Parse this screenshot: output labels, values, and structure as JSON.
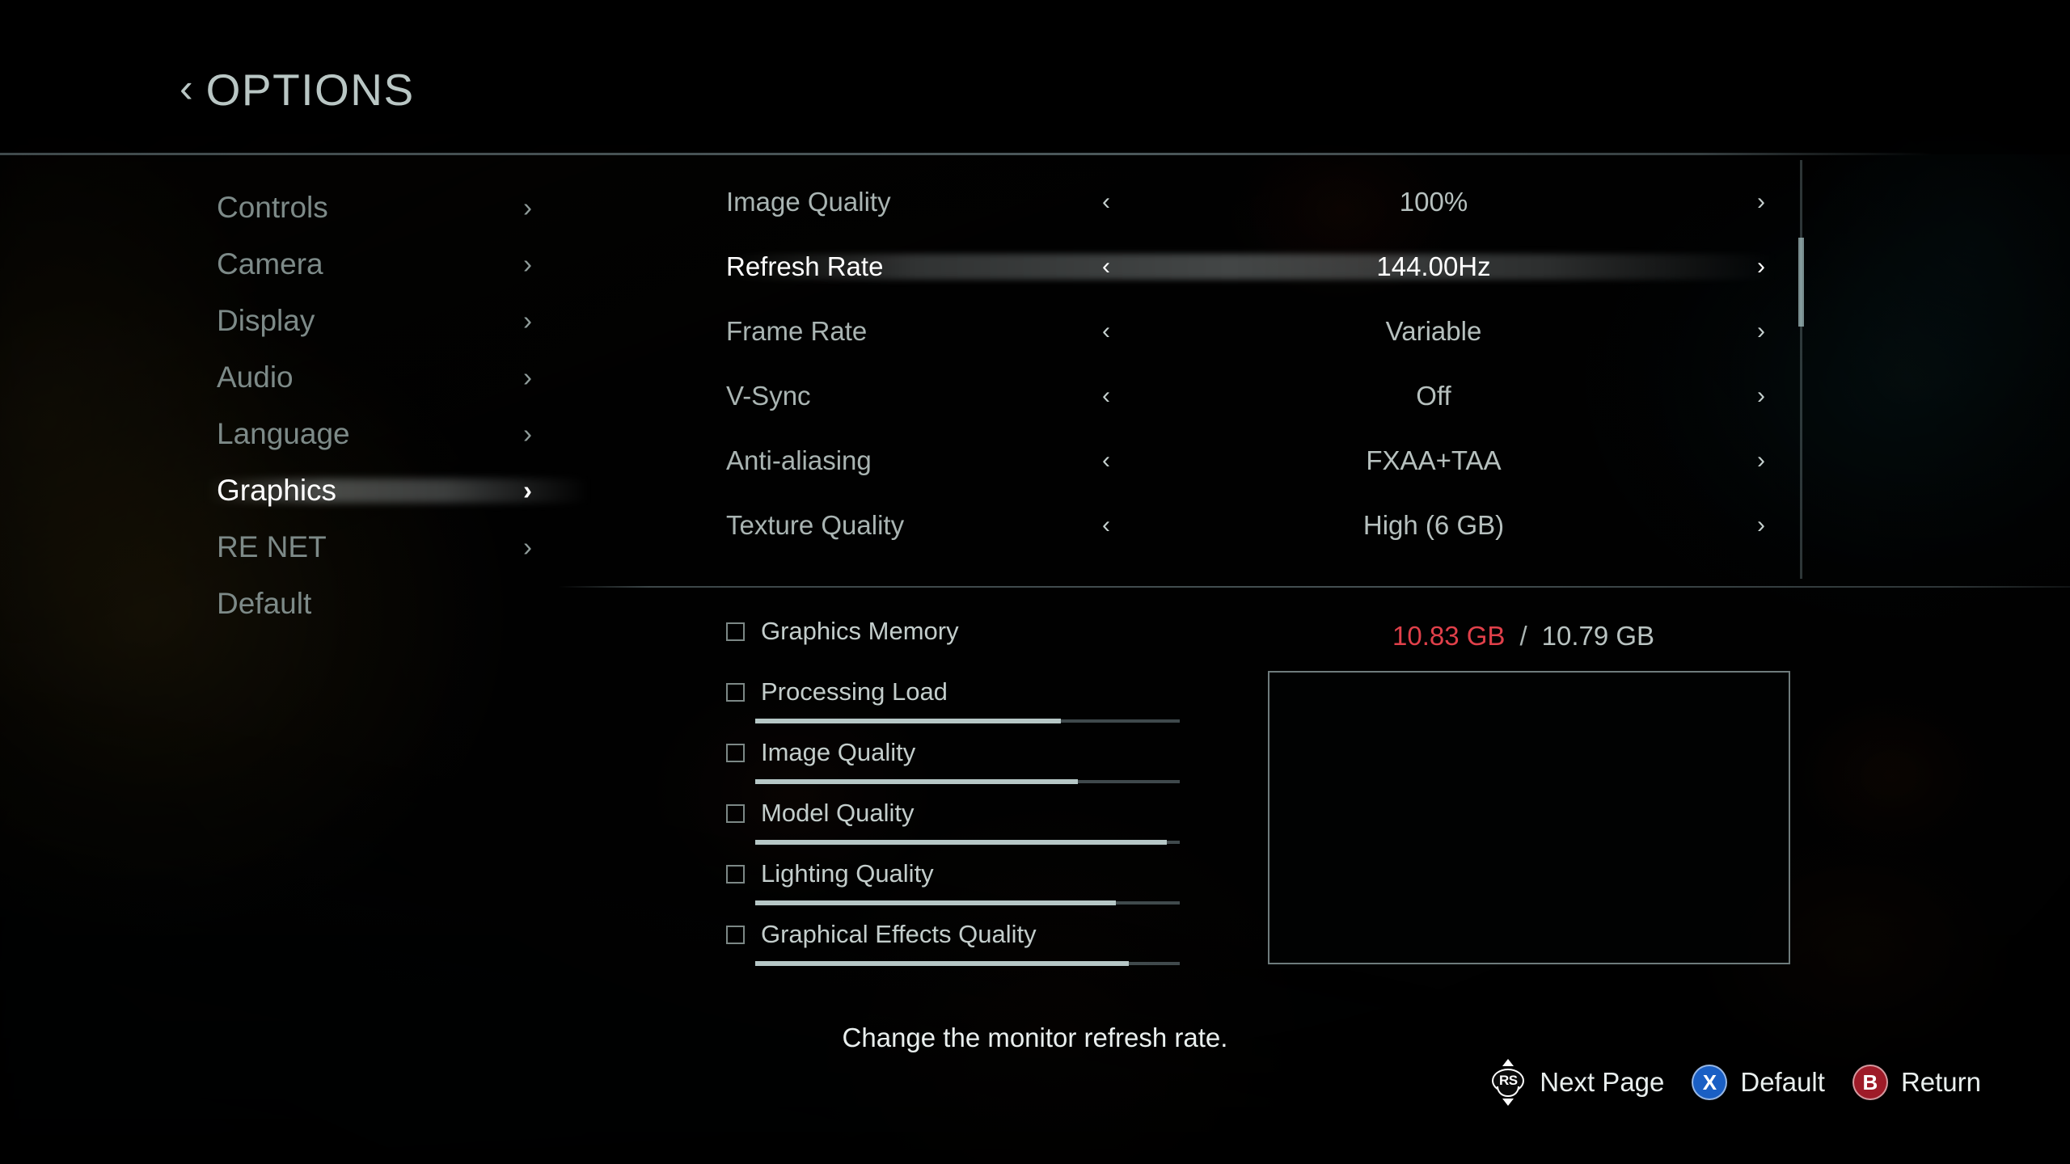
{
  "header": {
    "back_icon": "chevron-left-icon",
    "title": "OPTIONS"
  },
  "sidebar": {
    "items": [
      {
        "label": "Controls",
        "selected": false,
        "chevron": "›"
      },
      {
        "label": "Camera",
        "selected": false,
        "chevron": "›"
      },
      {
        "label": "Display",
        "selected": false,
        "chevron": "›"
      },
      {
        "label": "Audio",
        "selected": false,
        "chevron": "›"
      },
      {
        "label": "Language",
        "selected": false,
        "chevron": "›"
      },
      {
        "label": "Graphics",
        "selected": true,
        "chevron": "›"
      },
      {
        "label": "RE NET",
        "selected": false,
        "chevron": "›"
      },
      {
        "label": "Default",
        "selected": false,
        "chevron": ""
      }
    ]
  },
  "settings": {
    "left_arrow": "‹",
    "right_arrow": "›",
    "rows": [
      {
        "name": "Image Quality",
        "value": "100%",
        "selected": false
      },
      {
        "name": "Refresh Rate",
        "value": "144.00Hz",
        "selected": true
      },
      {
        "name": "Frame Rate",
        "value": "Variable",
        "selected": false
      },
      {
        "name": "V-Sync",
        "value": "Off",
        "selected": false
      },
      {
        "name": "Anti-aliasing",
        "value": "FXAA+TAA",
        "selected": false
      },
      {
        "name": "Texture Quality",
        "value": "High (6 GB)",
        "selected": false
      }
    ],
    "scrollbar": {
      "thumb_top_pct": 18,
      "thumb_height_pct": 21
    }
  },
  "meters": {
    "rows": [
      {
        "label": "Graphics Memory",
        "fill_pct": null
      },
      {
        "label": "Processing Load",
        "fill_pct": 72
      },
      {
        "label": "Image Quality",
        "fill_pct": 76
      },
      {
        "label": "Model Quality",
        "fill_pct": 97
      },
      {
        "label": "Lighting Quality",
        "fill_pct": 85
      },
      {
        "label": "Graphical Effects Quality",
        "fill_pct": 88
      }
    ],
    "memory": {
      "used": "10.83 GB",
      "separator": "/",
      "total": "10.79 GB",
      "used_color": "#e0404a",
      "total_color": "#b9c3c1"
    }
  },
  "preview": {
    "label": "graphics-preview-box"
  },
  "footer": {
    "help_text": "Change the monitor refresh rate.",
    "prompts": [
      {
        "icon": "right-stick-icon",
        "glyph": "RS",
        "label": "Next Page"
      },
      {
        "icon": "button-x-icon",
        "glyph": "X",
        "label": "Default"
      },
      {
        "icon": "button-b-icon",
        "glyph": "B",
        "label": "Return"
      }
    ]
  }
}
